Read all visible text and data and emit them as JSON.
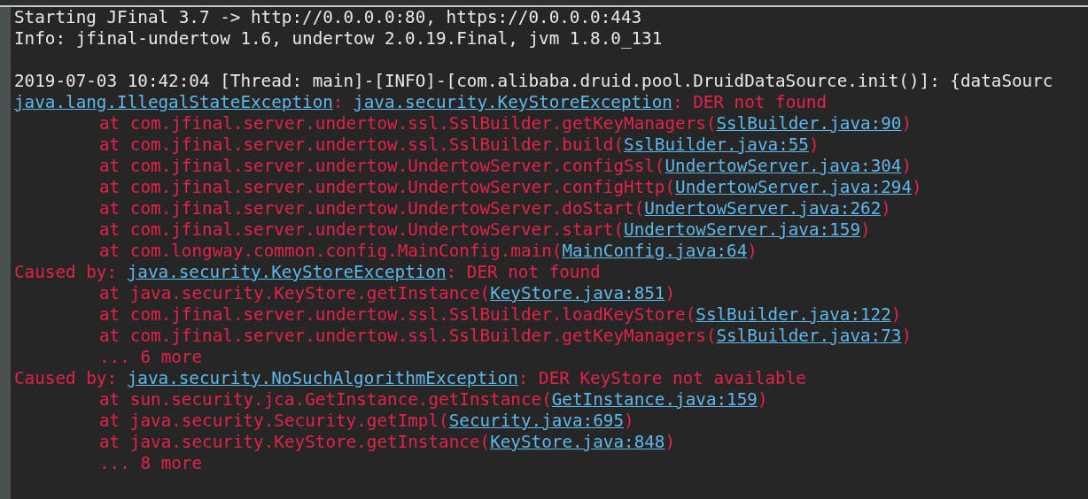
{
  "console": {
    "lines": [
      {
        "kind": "plain",
        "segments": [
          {
            "kind": "plain",
            "text": "Starting JFinal 3.7 -> http://0.0.0.0:80, https://0.0.0.0:443"
          }
        ]
      },
      {
        "kind": "plain",
        "segments": [
          {
            "kind": "plain",
            "text": "Info: jfinal-undertow 1.6, undertow 2.0.19.Final, jvm 1.8.0_131"
          }
        ]
      },
      {
        "kind": "blank"
      },
      {
        "kind": "plain",
        "segments": [
          {
            "kind": "plain",
            "text": "2019-07-03 10:42:04 [Thread: main]-[INFO]-[com.alibaba.druid.pool.DruidDataSource.init()]: {dataSourc"
          }
        ]
      },
      {
        "kind": "plain",
        "segments": [
          {
            "kind": "link",
            "text": "java.lang.IllegalStateException"
          },
          {
            "kind": "error",
            "text": ": "
          },
          {
            "kind": "link",
            "text": "java.security.KeyStoreException"
          },
          {
            "kind": "error",
            "text": ": DER not found"
          }
        ]
      },
      {
        "kind": "frame",
        "segments": [
          {
            "kind": "error",
            "text": "at com.jfinal.server.undertow.ssl.SslBuilder.getKeyManagers("
          },
          {
            "kind": "link",
            "text": "SslBuilder.java:90"
          },
          {
            "kind": "error",
            "text": ")"
          }
        ]
      },
      {
        "kind": "frame",
        "segments": [
          {
            "kind": "error",
            "text": "at com.jfinal.server.undertow.ssl.SslBuilder.build("
          },
          {
            "kind": "link",
            "text": "SslBuilder.java:55"
          },
          {
            "kind": "error",
            "text": ")"
          }
        ]
      },
      {
        "kind": "frame",
        "segments": [
          {
            "kind": "error",
            "text": "at com.jfinal.server.undertow.UndertowServer.configSsl("
          },
          {
            "kind": "link",
            "text": "UndertowServer.java:304"
          },
          {
            "kind": "error",
            "text": ")"
          }
        ]
      },
      {
        "kind": "frame",
        "segments": [
          {
            "kind": "error",
            "text": "at com.jfinal.server.undertow.UndertowServer.configHttp("
          },
          {
            "kind": "link",
            "text": "UndertowServer.java:294"
          },
          {
            "kind": "error",
            "text": ")"
          }
        ]
      },
      {
        "kind": "frame",
        "segments": [
          {
            "kind": "error",
            "text": "at com.jfinal.server.undertow.UndertowServer.doStart("
          },
          {
            "kind": "link",
            "text": "UndertowServer.java:262"
          },
          {
            "kind": "error",
            "text": ")"
          }
        ]
      },
      {
        "kind": "frame",
        "segments": [
          {
            "kind": "error",
            "text": "at com.jfinal.server.undertow.UndertowServer.start("
          },
          {
            "kind": "link",
            "text": "UndertowServer.java:159"
          },
          {
            "kind": "error",
            "text": ")"
          }
        ]
      },
      {
        "kind": "frame",
        "segments": [
          {
            "kind": "error",
            "text": "at com.longway.common.config.MainConfig.main("
          },
          {
            "kind": "link",
            "text": "MainConfig.java:64"
          },
          {
            "kind": "error",
            "text": ")"
          }
        ]
      },
      {
        "kind": "plain",
        "segments": [
          {
            "kind": "error",
            "text": "Caused by: "
          },
          {
            "kind": "link",
            "text": "java.security.KeyStoreException"
          },
          {
            "kind": "error",
            "text": ": DER not found"
          }
        ]
      },
      {
        "kind": "frame",
        "segments": [
          {
            "kind": "error",
            "text": "at java.security.KeyStore.getInstance("
          },
          {
            "kind": "link",
            "text": "KeyStore.java:851"
          },
          {
            "kind": "error",
            "text": ")"
          }
        ]
      },
      {
        "kind": "frame",
        "segments": [
          {
            "kind": "error",
            "text": "at com.jfinal.server.undertow.ssl.SslBuilder.loadKeyStore("
          },
          {
            "kind": "link",
            "text": "SslBuilder.java:122"
          },
          {
            "kind": "error",
            "text": ")"
          }
        ]
      },
      {
        "kind": "frame",
        "segments": [
          {
            "kind": "error",
            "text": "at com.jfinal.server.undertow.ssl.SslBuilder.getKeyManagers("
          },
          {
            "kind": "link",
            "text": "SslBuilder.java:73"
          },
          {
            "kind": "error",
            "text": ")"
          }
        ]
      },
      {
        "kind": "frame",
        "segments": [
          {
            "kind": "error",
            "text": "... 6 more"
          }
        ]
      },
      {
        "kind": "plain",
        "segments": [
          {
            "kind": "error",
            "text": "Caused by: "
          },
          {
            "kind": "link",
            "text": "java.security.NoSuchAlgorithmException"
          },
          {
            "kind": "error",
            "text": ": DER KeyStore not available"
          }
        ]
      },
      {
        "kind": "frame",
        "segments": [
          {
            "kind": "error",
            "text": "at sun.security.jca.GetInstance.getInstance("
          },
          {
            "kind": "link",
            "text": "GetInstance.java:159"
          },
          {
            "kind": "error",
            "text": ")"
          }
        ]
      },
      {
        "kind": "frame",
        "segments": [
          {
            "kind": "error",
            "text": "at java.security.Security.getImpl("
          },
          {
            "kind": "link",
            "text": "Security.java:695"
          },
          {
            "kind": "error",
            "text": ")"
          }
        ]
      },
      {
        "kind": "frame",
        "segments": [
          {
            "kind": "error",
            "text": "at java.security.KeyStore.getInstance("
          },
          {
            "kind": "link",
            "text": "KeyStore.java:848"
          },
          {
            "kind": "error",
            "text": ")"
          }
        ]
      },
      {
        "kind": "frame",
        "segments": [
          {
            "kind": "error",
            "text": "... 8 more"
          }
        ]
      }
    ]
  }
}
